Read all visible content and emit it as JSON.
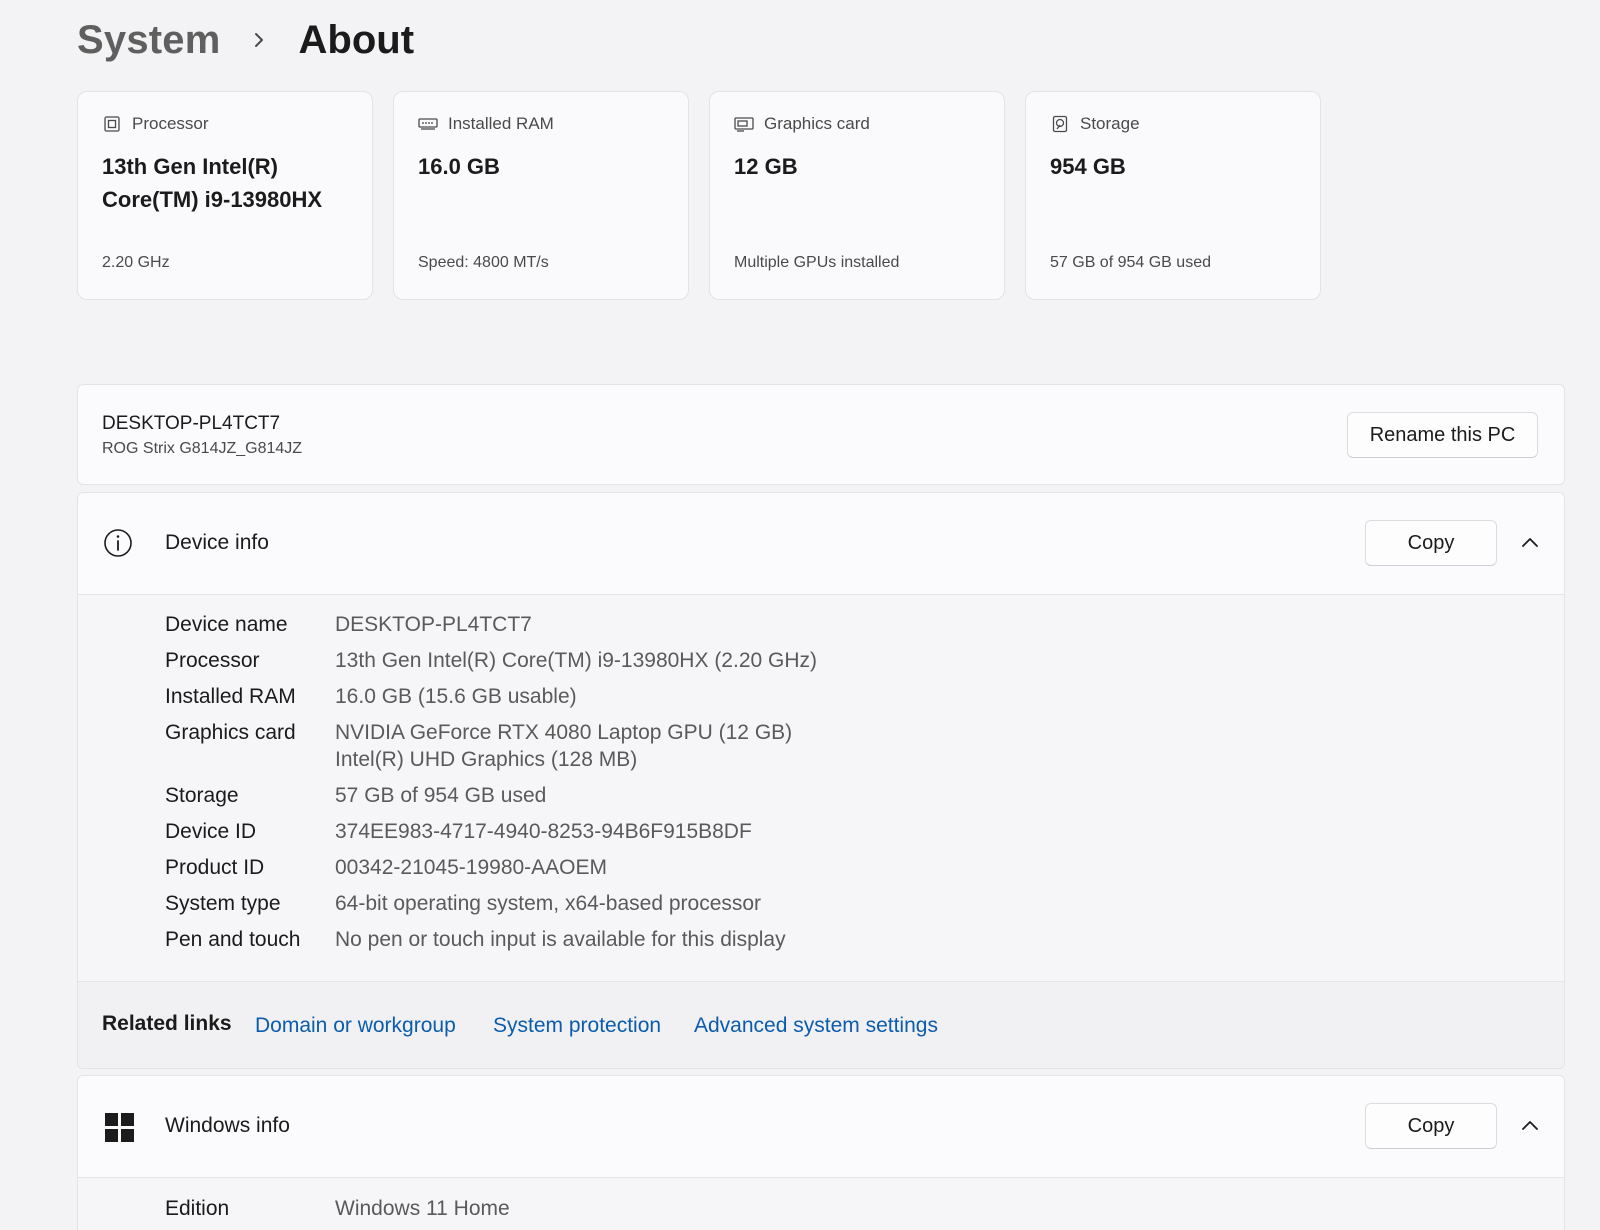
{
  "breadcrumb": {
    "parent": "System",
    "current": "About"
  },
  "cards": [
    {
      "icon": "processor-icon",
      "label": "Processor",
      "value": "13th Gen Intel(R) Core(TM) i9-13980HX",
      "sub": "2.20 GHz"
    },
    {
      "icon": "ram-icon",
      "label": "Installed RAM",
      "value": "16.0 GB",
      "sub": "Speed: 4800 MT/s"
    },
    {
      "icon": "graphics-card-icon",
      "label": "Graphics card",
      "value": "12 GB",
      "sub": "Multiple GPUs installed"
    },
    {
      "icon": "storage-icon",
      "label": "Storage",
      "value": "954 GB",
      "sub": "57 GB of 954 GB used"
    }
  ],
  "pc": {
    "name": "DESKTOP-PL4TCT7",
    "model": "ROG Strix G814JZ_G814JZ",
    "rename_label": "Rename this PC"
  },
  "device_info": {
    "title": "Device info",
    "copy_label": "Copy",
    "rows": [
      {
        "label": "Device name",
        "value": "DESKTOP-PL4TCT7"
      },
      {
        "label": "Processor",
        "value": "13th Gen Intel(R) Core(TM) i9-13980HX (2.20 GHz)"
      },
      {
        "label": "Installed RAM",
        "value": "16.0 GB (15.6 GB usable)"
      },
      {
        "label": "Graphics card",
        "value": "NVIDIA GeForce RTX 4080 Laptop GPU (12 GB)\nIntel(R) UHD Graphics (128 MB)"
      },
      {
        "label": "Storage",
        "value": "57 GB of 954 GB used"
      },
      {
        "label": "Device ID",
        "value": "374EE983-4717-4940-8253-94B6F915B8DF"
      },
      {
        "label": "Product ID",
        "value": "00342-21045-19980-AAOEM"
      },
      {
        "label": "System type",
        "value": "64-bit operating system, x64-based processor"
      },
      {
        "label": "Pen and touch",
        "value": "No pen or touch input is available for this display"
      }
    ]
  },
  "related_links": {
    "label": "Related links",
    "links": [
      "Domain or workgroup",
      "System protection",
      "Advanced system settings"
    ]
  },
  "windows_info": {
    "title": "Windows info",
    "copy_label": "Copy",
    "rows": [
      {
        "label": "Edition",
        "value": "Windows 11 Home"
      }
    ]
  },
  "colors": {
    "background": "#f3f3f5",
    "card": "#fafafc",
    "link": "#0b5cad"
  }
}
